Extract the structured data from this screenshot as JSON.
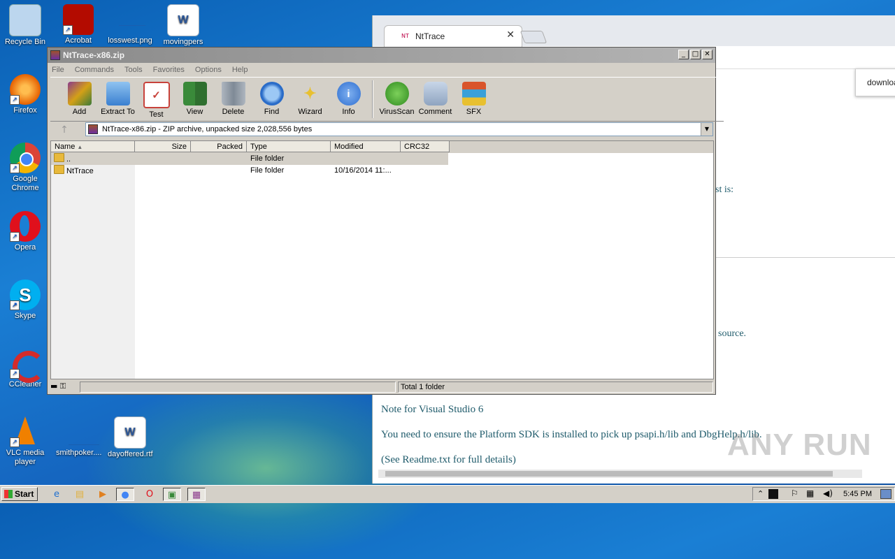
{
  "desktop": {
    "icons": [
      {
        "label": "Recycle Bin",
        "icon": "recycle-bin-icon",
        "color": "#bcd6ee"
      },
      {
        "label": "Acrobat",
        "icon": "acrobat-icon",
        "color": "#b30b00"
      },
      {
        "label": "losswest.png",
        "icon": "image-file-icon",
        "color": "#1a5fb0"
      },
      {
        "label": "movingpers",
        "icon": "word-doc-icon",
        "color": "#2b579a"
      },
      {
        "label": "Firefox",
        "icon": "firefox-icon",
        "color": "#e66000"
      },
      {
        "label": "Google Chrome",
        "icon": "chrome-icon",
        "color": "#4285f4"
      },
      {
        "label": "Opera",
        "icon": "opera-icon",
        "color": "#e0101c"
      },
      {
        "label": "Skype",
        "icon": "skype-icon",
        "color": "#00aff0"
      },
      {
        "label": "CCleaner",
        "icon": "ccleaner-icon",
        "color": "#d42b2b"
      },
      {
        "label": "VLC media player",
        "icon": "vlc-icon",
        "color": "#f08000"
      },
      {
        "label": "smithpoker....",
        "icon": "file-icon",
        "color": "#1a5fb0"
      },
      {
        "label": "dayoffered.rtf",
        "icon": "word-doc-icon",
        "color": "#2b579a"
      }
    ]
  },
  "browser": {
    "tab_title": "NtTrace",
    "tab_favicon": "NT",
    "popup_text": "downloa",
    "lines": {
      "list_is": "st is:",
      "source": "source.",
      "note": "Note for Visual Studio 6",
      "platform": "You need to ensure the Platform SDK is installed to pick up psapi.h/lib and DbgHelp.h/lib.",
      "readme": "(See Readme.txt for full details)"
    }
  },
  "winrar": {
    "title": "NtTrace-x86.zip",
    "menu": [
      "File",
      "Commands",
      "Tools",
      "Favorites",
      "Options",
      "Help"
    ],
    "tools": [
      {
        "label": "Add",
        "icon": "add-archive-icon",
        "color": "#8b3a8b"
      },
      {
        "label": "Extract To",
        "icon": "extract-folder-icon",
        "color": "#4a90d9"
      },
      {
        "label": "Test",
        "icon": "test-clipboard-icon",
        "color": "#c8423b"
      },
      {
        "label": "View",
        "icon": "view-book-icon",
        "color": "#3a8a3a"
      },
      {
        "label": "Delete",
        "icon": "delete-bin-icon",
        "color": "#7f8a96"
      },
      {
        "label": "Find",
        "icon": "find-magnifier-icon",
        "color": "#2a6cc8"
      },
      {
        "label": "Wizard",
        "icon": "wizard-wand-icon",
        "color": "#9aa9b8"
      },
      {
        "label": "Info",
        "icon": "info-icon",
        "color": "#2f6fd0"
      },
      {
        "label": "VirusScan",
        "icon": "virusscan-bug-icon",
        "color": "#3a9a2a"
      },
      {
        "label": "Comment",
        "icon": "comment-icon",
        "color": "#8fa4c0"
      },
      {
        "label": "SFX",
        "icon": "sfx-box-icon",
        "color": "#d9542b"
      }
    ],
    "path": "NtTrace-x86.zip - ZIP archive, unpacked size 2,028,556 bytes",
    "columns": [
      "Name",
      "Size",
      "Packed",
      "Type",
      "Modified",
      "CRC32"
    ],
    "rows": [
      {
        "name": "..",
        "size": "",
        "packed": "",
        "type": "File folder",
        "modified": "",
        "crc": ""
      },
      {
        "name": "NtTrace",
        "size": "",
        "packed": "",
        "type": "File folder",
        "modified": "10/16/2014 11:...",
        "crc": ""
      }
    ],
    "status": "Total 1 folder"
  },
  "taskbar": {
    "start_label": "Start",
    "clock": "5:45 PM"
  },
  "watermark": "ANY RUN"
}
